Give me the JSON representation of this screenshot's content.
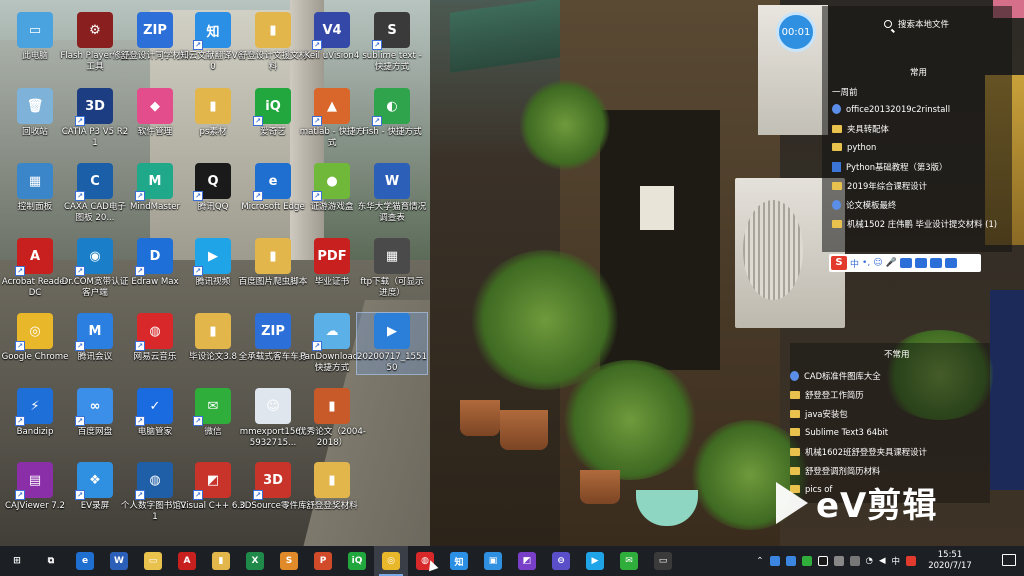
{
  "desktop": {
    "icons": [
      {
        "label": "此电脑",
        "color": "#4aa3df",
        "glyph": "▭",
        "x": 1,
        "y": 1,
        "sc": false
      },
      {
        "label": "Flash Player修复工具",
        "color": "#8a1f1f",
        "glyph": "⚙",
        "x": 2,
        "y": 1,
        "sc": false
      },
      {
        "label": "舒登设计同学材料",
        "color": "#2d6fd8",
        "glyph": "ZIP",
        "x": 3,
        "y": 1,
        "sc": false
      },
      {
        "label": "知云文献翻译V6.0",
        "color": "#2b8fe6",
        "glyph": "知",
        "x": 4,
        "y": 1,
        "sc": true
      },
      {
        "label": "舒登设计文援文材料",
        "color": "#e2b64a",
        "glyph": "▮",
        "x": 5,
        "y": 1,
        "sc": false
      },
      {
        "label": "Keil uVision4",
        "color": "#3448a8",
        "glyph": "V4",
        "x": 6,
        "y": 1,
        "sc": true
      },
      {
        "label": "sublime text - 快捷方式",
        "color": "#3a3a3a",
        "glyph": "S",
        "x": 7,
        "y": 1,
        "sc": true
      },
      {
        "label": "回收站",
        "color": "#7fb2d8",
        "glyph": "🗑",
        "x": 1,
        "y": 2,
        "sc": false
      },
      {
        "label": "CATIA P3 V5 R21",
        "color": "#1d3d82",
        "glyph": "3D",
        "x": 2,
        "y": 2,
        "sc": true
      },
      {
        "label": "软件管理",
        "color": "#e34d8b",
        "glyph": "◆",
        "x": 3,
        "y": 2,
        "sc": false
      },
      {
        "label": "ps素材",
        "color": "#e2b64a",
        "glyph": "▮",
        "x": 4,
        "y": 2,
        "sc": false
      },
      {
        "label": "爱奇艺",
        "color": "#22a73f",
        "glyph": "iQ",
        "x": 5,
        "y": 2,
        "sc": true
      },
      {
        "label": "matlab - 快捷方式",
        "color": "#d9662a",
        "glyph": "▲",
        "x": 6,
        "y": 2,
        "sc": true
      },
      {
        "label": "Fish - 快捷方式",
        "color": "#2fa44d",
        "glyph": "◐",
        "x": 7,
        "y": 2,
        "sc": true
      },
      {
        "label": "控制面板",
        "color": "#3b86c8",
        "glyph": "▦",
        "x": 1,
        "y": 3,
        "sc": false
      },
      {
        "label": "CAXA CAD电子图板 20...",
        "color": "#1a5fa8",
        "glyph": "C",
        "x": 2,
        "y": 3,
        "sc": true
      },
      {
        "label": "MindMaster",
        "color": "#1fa98a",
        "glyph": "M",
        "x": 3,
        "y": 3,
        "sc": true
      },
      {
        "label": "腾讯QQ",
        "color": "#1a1a1a",
        "glyph": "Q",
        "x": 4,
        "y": 3,
        "sc": true
      },
      {
        "label": "Microsoft Edge",
        "color": "#1f6fd1",
        "glyph": "e",
        "x": 5,
        "y": 3,
        "sc": true
      },
      {
        "label": "证游游戏盒",
        "color": "#6fb83a",
        "glyph": "●",
        "x": 6,
        "y": 3,
        "sc": true
      },
      {
        "label": "东华大学猫育情况调查表",
        "color": "#2b5fb8",
        "glyph": "W",
        "x": 7,
        "y": 3,
        "sc": false
      },
      {
        "label": "Acrobat Reader DC",
        "color": "#c8201e",
        "glyph": "A",
        "x": 1,
        "y": 4,
        "sc": true
      },
      {
        "label": "Dr.COM宽带认证客户端",
        "color": "#1a7fc8",
        "glyph": "◉",
        "x": 2,
        "y": 4,
        "sc": true
      },
      {
        "label": "Edraw Max",
        "color": "#1e6fd8",
        "glyph": "D",
        "x": 3,
        "y": 4,
        "sc": true
      },
      {
        "label": "腾讯视频",
        "color": "#1fa4e8",
        "glyph": "▶",
        "x": 4,
        "y": 4,
        "sc": true
      },
      {
        "label": "百度图片爬虫脚本",
        "color": "#e2b64a",
        "glyph": "▮",
        "x": 5,
        "y": 4,
        "sc": false
      },
      {
        "label": "毕业证书",
        "color": "#c8201e",
        "glyph": "PDF",
        "x": 6,
        "y": 4,
        "sc": false
      },
      {
        "label": "ftp下载（可显示进度）",
        "color": "#4a4a4a",
        "glyph": "▦",
        "x": 7,
        "y": 4,
        "sc": false
      },
      {
        "label": "Google Chrome",
        "color": "#e9b72a",
        "glyph": "◎",
        "x": 1,
        "y": 5,
        "sc": true
      },
      {
        "label": "腾讯会议",
        "color": "#2b7fe0",
        "glyph": "M",
        "x": 2,
        "y": 5,
        "sc": true
      },
      {
        "label": "网易云音乐",
        "color": "#d8282a",
        "glyph": "◍",
        "x": 3,
        "y": 5,
        "sc": true
      },
      {
        "label": "毕设论文3.8",
        "color": "#e2b64a",
        "glyph": "▮",
        "x": 4,
        "y": 5,
        "sc": false
      },
      {
        "label": "全承载式客车车身",
        "color": "#2d6fd8",
        "glyph": "ZIP",
        "x": 5,
        "y": 5,
        "sc": false
      },
      {
        "label": "PanDownload - 快捷方式",
        "color": "#5bb0e8",
        "glyph": "☁",
        "x": 6,
        "y": 5,
        "sc": true
      },
      {
        "label": "20200717_155150",
        "color": "#2b7fd8",
        "glyph": "▶",
        "x": 7,
        "y": 5,
        "sc": false,
        "selected": true
      },
      {
        "label": "Bandizip",
        "color": "#1e6fd8",
        "glyph": "⚡",
        "x": 1,
        "y": 6,
        "sc": true
      },
      {
        "label": "百度网盘",
        "color": "#3c8fe8",
        "glyph": "∞",
        "x": 2,
        "y": 6,
        "sc": true
      },
      {
        "label": "电脑管家",
        "color": "#1a6ae0",
        "glyph": "✓",
        "x": 3,
        "y": 6,
        "sc": true
      },
      {
        "label": "微信",
        "color": "#2fae3c",
        "glyph": "✉",
        "x": 4,
        "y": 6,
        "sc": true
      },
      {
        "label": "mmexport15675932715...",
        "color": "#dfe6ee",
        "glyph": "☺",
        "x": 5,
        "y": 6,
        "sc": false
      },
      {
        "label": "优秀论文（2004-2018）",
        "color": "#c85a2a",
        "glyph": "▮",
        "x": 6,
        "y": 6,
        "sc": false
      },
      {
        "label": "CAJViewer 7.2",
        "color": "#8a2fa8",
        "glyph": "▤",
        "x": 1,
        "y": 7,
        "sc": true
      },
      {
        "label": "EV录屏",
        "color": "#2f8fe0",
        "glyph": "❖",
        "x": 2,
        "y": 7,
        "sc": true
      },
      {
        "label": "个人数字图书馆2.1",
        "color": "#1f5fa8",
        "glyph": "◍",
        "x": 3,
        "y": 7,
        "sc": true
      },
      {
        "label": "Visual C++ 6.0",
        "color": "#c8332a",
        "glyph": "◩",
        "x": 4,
        "y": 7,
        "sc": true
      },
      {
        "label": "3DSource零件库",
        "color": "#c8332a",
        "glyph": "3D",
        "x": 5,
        "y": 7,
        "sc": true
      },
      {
        "label": "舒登登奖材料",
        "color": "#e2b64a",
        "glyph": "▮",
        "x": 6,
        "y": 7,
        "sc": false
      }
    ]
  },
  "timer": {
    "value": "00:01"
  },
  "filepanel": {
    "search_placeholder": "搜索本地文件",
    "frequent_label": "常用",
    "week_label": "一周前",
    "recent": [
      {
        "label": "office20132019c2rinstall",
        "kind": "app"
      },
      {
        "label": "夹具转配体",
        "kind": "folder"
      },
      {
        "label": "python",
        "kind": "folder"
      },
      {
        "label": "Python基础教程（第3版）",
        "kind": "doc"
      },
      {
        "label": "2019年综合课程设计",
        "kind": "folder"
      },
      {
        "label": "论文模板最终",
        "kind": "app"
      },
      {
        "label": "机械1502 庄伟鹏 毕业设计提交材料 (1)",
        "kind": "folder"
      }
    ],
    "infrequent_label": "不常用",
    "infrequent": [
      {
        "label": "CAD标准件图库大全",
        "kind": "app"
      },
      {
        "label": "舒登登工作简历",
        "kind": "folder"
      },
      {
        "label": "java安装包",
        "kind": "folder"
      },
      {
        "label": "Sublime Text3 64bit",
        "kind": "folder"
      },
      {
        "label": "机械1602班舒登登夹具课程设计",
        "kind": "folder"
      },
      {
        "label": "舒登登调剂简历材料",
        "kind": "folder"
      },
      {
        "label": "pics of",
        "kind": "folder"
      }
    ]
  },
  "ime": {
    "label": "中"
  },
  "watermark": {
    "text": "eV剪辑"
  },
  "taskbar": {
    "apps": [
      {
        "name": "windows-start",
        "color": "#ffffff",
        "glyph": "⊞"
      },
      {
        "name": "task-view",
        "color": "#ffffff",
        "glyph": "⧉"
      },
      {
        "name": "edge",
        "color": "#1f6fd1",
        "glyph": "e"
      },
      {
        "name": "word",
        "color": "#2b5fb8",
        "glyph": "W"
      },
      {
        "name": "file-explorer",
        "color": "#e9c24d",
        "glyph": "▭"
      },
      {
        "name": "acrobat",
        "color": "#c8201e",
        "glyph": "A"
      },
      {
        "name": "notepad",
        "color": "#e2b64a",
        "glyph": "▮"
      },
      {
        "name": "excel",
        "color": "#1f8a4a",
        "glyph": "X"
      },
      {
        "name": "sublime",
        "color": "#e08a2a",
        "glyph": "S"
      },
      {
        "name": "powerpoint",
        "color": "#d14a2a",
        "glyph": "P"
      },
      {
        "name": "iqiyi",
        "color": "#22a73f",
        "glyph": "iQ"
      },
      {
        "name": "chrome",
        "color": "#e9b72a",
        "glyph": "◎",
        "active": true,
        "hl": true
      },
      {
        "name": "netease-music",
        "color": "#d8282a",
        "glyph": "◍"
      },
      {
        "name": "zhiyun",
        "color": "#2b8fe6",
        "glyph": "知"
      },
      {
        "name": "screen-recorder",
        "color": "#2f8fe0",
        "glyph": "▣"
      },
      {
        "name": "visual-studio",
        "color": "#7a3fc8",
        "glyph": "◩"
      },
      {
        "name": "app-purple",
        "color": "#5a4fc8",
        "glyph": "⊖"
      },
      {
        "name": "tencent-video",
        "color": "#1fa4e8",
        "glyph": "▶"
      },
      {
        "name": "wechat",
        "color": "#2fae3c",
        "glyph": "✉"
      },
      {
        "name": "app-dark",
        "color": "#3a3a3a",
        "glyph": "▭"
      }
    ],
    "tray_ime": "中",
    "time": "15:51",
    "date": "2020/7/17"
  }
}
